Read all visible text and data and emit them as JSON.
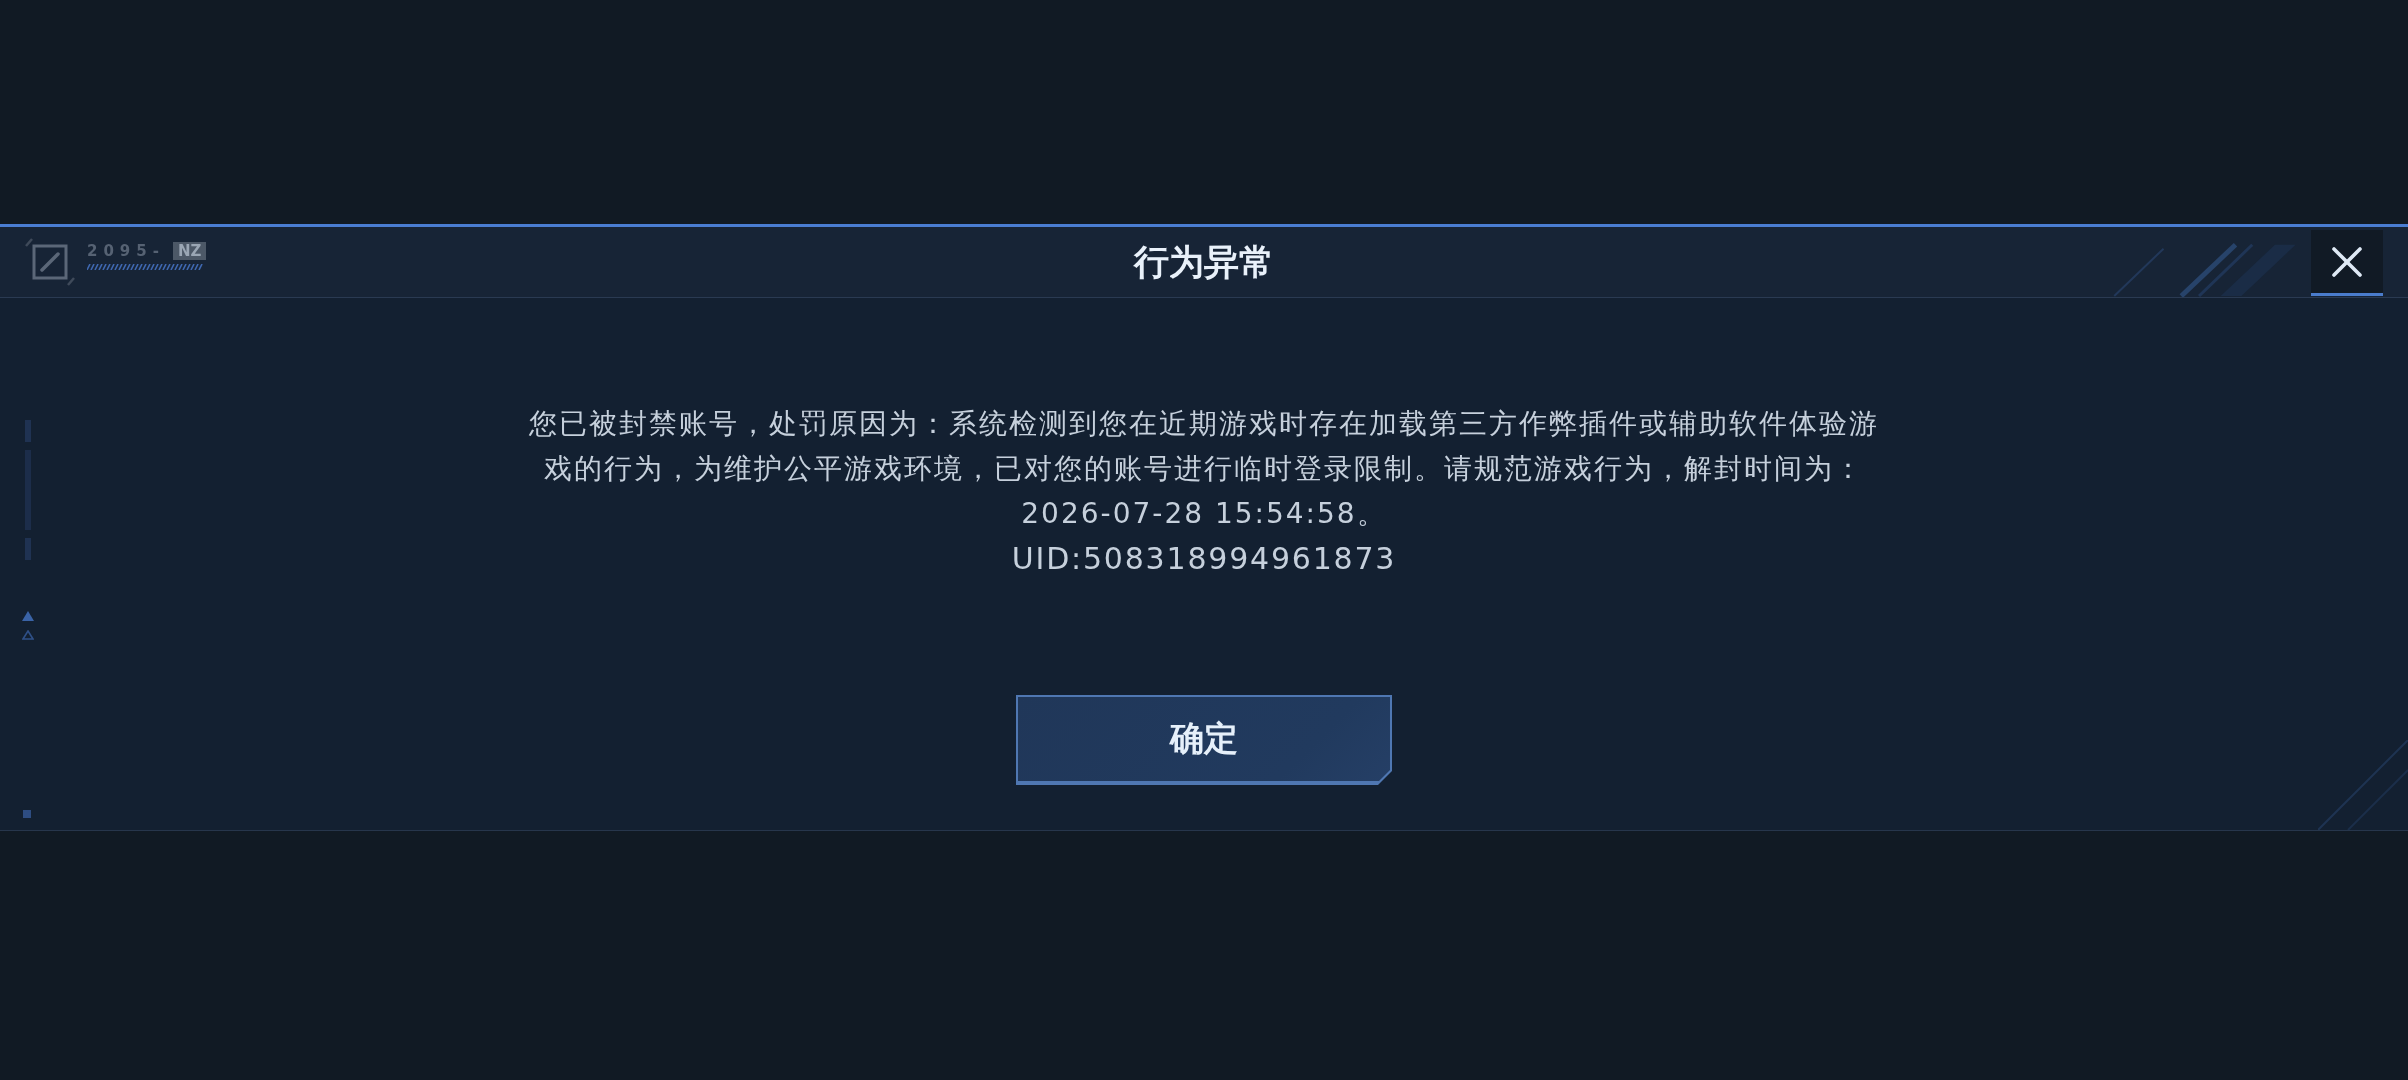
{
  "header": {
    "logo": {
      "code": "2095-",
      "tag": "NZ"
    },
    "title": "行为异常"
  },
  "message": {
    "text": "您已被封禁账号，处罚原因为：系统检测到您在近期游戏时存在加载第三方作弊插件或辅助软件体验游戏的行为，为维护公平游戏环境，已对您的账号进行临时登录限制。请规范游戏行为，解封时间为：2026-07-28 15:54:58。",
    "uid": "UID:508318994961873"
  },
  "confirm_button": {
    "label": "确定"
  }
}
